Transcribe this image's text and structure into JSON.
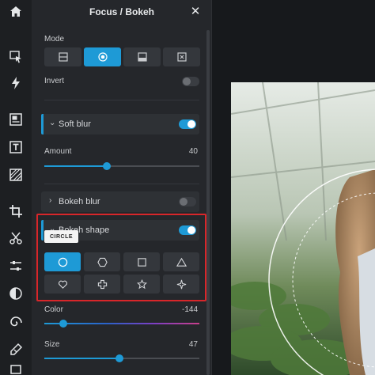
{
  "panel": {
    "title": "Focus / Bokeh",
    "mode_label": "Mode",
    "invert_label": "Invert",
    "soft_blur": {
      "title": "Soft blur"
    },
    "amount": {
      "label": "Amount",
      "value": "40",
      "level": 0.4
    },
    "bokeh_blur": {
      "title": "Bokeh blur"
    },
    "bokeh_shape": {
      "title": "Bokeh shape"
    },
    "tooltip": "CIRCLE",
    "color": {
      "label": "Color",
      "value": "-144"
    },
    "size": {
      "label": "Size",
      "value": "47",
      "level": 0.47
    }
  },
  "mode_buttons": [
    "linear-mode-icon",
    "circle-mode-icon",
    "bottom-mode-icon",
    "box-mode-icon"
  ],
  "shape_buttons": [
    "circle",
    "hexagon",
    "square",
    "triangle",
    "heart",
    "cross",
    "star",
    "sparkle"
  ],
  "toggles": {
    "invert": false,
    "soft_blur": true,
    "bokeh_blur": false,
    "bokeh_shape": true
  },
  "colors": {
    "accent": "#1e9ad6",
    "highlight": "#d8262a",
    "panel": "#25272b",
    "rail": "#1d1f22"
  }
}
